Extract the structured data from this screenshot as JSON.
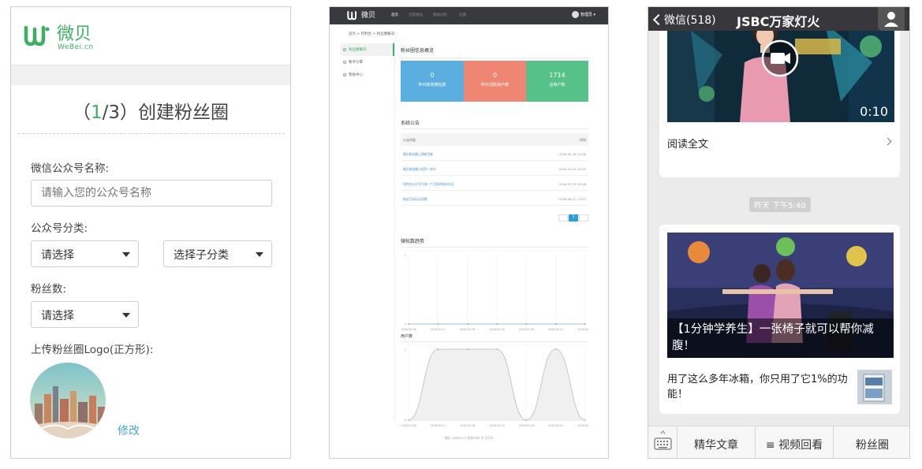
{
  "panel1": {
    "brand_name": "微贝",
    "brand_sub": "WeBei.cn",
    "title_prefix": "（",
    "title_step": "1",
    "title_rest": "/3）创建粉丝圈",
    "field_name_label": "微信公众号名称:",
    "field_name_placeholder": "请输入您的公众号名称",
    "category_label": "公众号分类:",
    "category_select": "请选择",
    "subcategory_select": "选择子分类",
    "fans_label": "粉丝数:",
    "fans_select": "请选择",
    "logo_label": "上传粉丝圈Logo(正方形):",
    "edit_link": "修改",
    "accent": "#3fae62"
  },
  "panel2": {
    "brand_name": "微贝",
    "nav": [
      "首页",
      "全部发帖",
      "数据分析",
      "设置"
    ],
    "user": "管理员",
    "breadcrumb": "首页 > 控制台 > 粉丝圈概况",
    "side": [
      "粉丝圈概况",
      "数字引擎",
      "帮助中心"
    ],
    "overview_title": "粉丝圈信息概览",
    "stats": [
      {
        "value": "0",
        "label": "昨日新增微帖数",
        "color": "#5aaee0"
      },
      {
        "value": "0",
        "label": "昨日活跃用户数",
        "color": "#ef8573"
      },
      {
        "value": "1714",
        "label": "总用户数",
        "color": "#56c28a"
      }
    ],
    "notice_title": "系统公告",
    "notice_head_content": "公告内容",
    "notice_head_time": "时间",
    "notices": [
      {
        "title": "微贝粉丝圈上线新功能",
        "time": "2016-05-18 15:36"
      },
      {
        "title": "微贝粉丝圈小程序一周年",
        "time": "2016-01-25 15:35"
      },
      {
        "title": "如何在公众号打造一个活跃的粉丝社区",
        "time": "2016-07-25 15:28"
      },
      {
        "title": "粉丝互动玩法详解",
        "time": "2016-08-27 13:07"
      }
    ],
    "page": "1",
    "posts_chart_title": "微帖数趋势",
    "users_chart_title": "用户数",
    "footer": "微贝 webei.cn 版权所有 © 2016"
  },
  "chart_data": [
    {
      "type": "line",
      "title": "微帖数趋势",
      "categories": [
        "2016-05-16",
        "2016-05-17",
        "2016-05-18",
        "2016-05-19",
        "2016-05-20",
        "2016-05-21",
        "2016-05-22"
      ],
      "series": [
        {
          "values": [
            0,
            0,
            0,
            0,
            0,
            0,
            0
          ]
        }
      ],
      "yticks": [
        "1",
        "0"
      ],
      "ylim": [
        0,
        1
      ]
    },
    {
      "type": "area",
      "title": "用户数",
      "categories": [
        "2016-05-16",
        "2016-05-17",
        "2016-05-18",
        "2016-05-19",
        "2016-05-20",
        "2016-05-21",
        "2016-05-22"
      ],
      "series": [
        {
          "values": [
            0,
            1,
            1,
            1,
            0,
            1,
            0
          ]
        }
      ],
      "yticks": [
        "1",
        "0"
      ],
      "ylim": [
        0,
        1
      ]
    }
  ],
  "panel3": {
    "back_label": "微信(518)",
    "title": "JSBC万家灯火",
    "video_duration": "0:10",
    "read_all": "阅读全文",
    "timestamp": "昨天 下午5:40",
    "article_caption": "【1分钟学养生】一张椅子就可以帮你减腹！",
    "article_sub": "用了这么多年冰箱，你只用了它1%的功能！",
    "tabs": [
      "精华文章",
      "≡ 视频回看",
      "粉丝圈"
    ]
  }
}
